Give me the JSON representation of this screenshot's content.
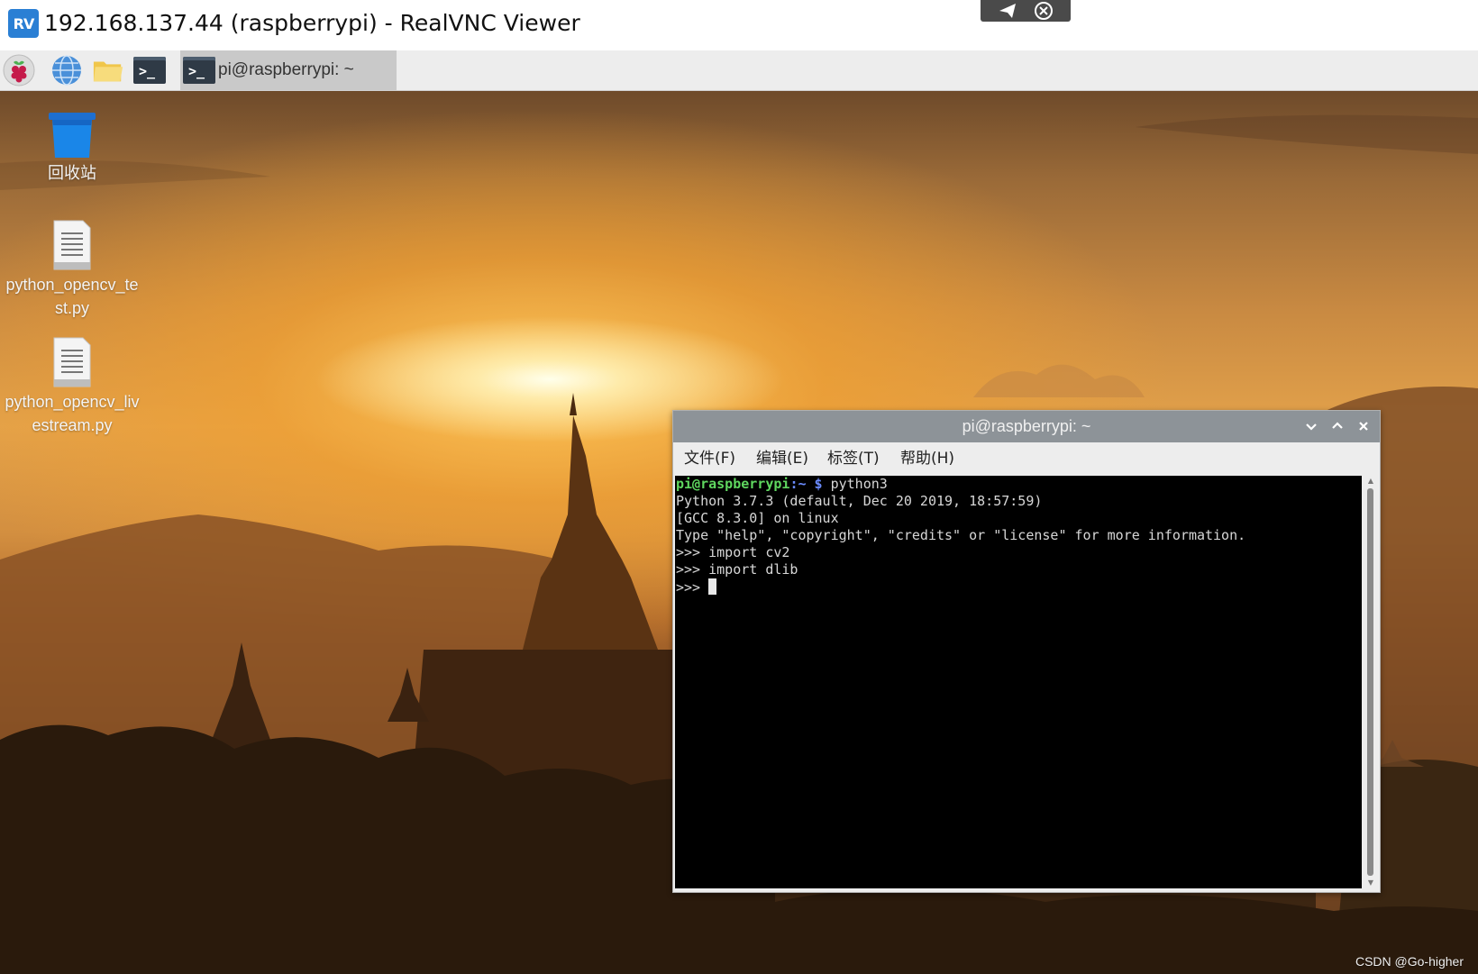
{
  "vnc": {
    "logo_text": "RV",
    "title": "192.168.137.44 (raspberrypi) - RealVNC Viewer",
    "toolbar_icons": [
      "send-icon",
      "close-circle-icon"
    ]
  },
  "taskbar": {
    "launchers": [
      "raspberry-menu-icon",
      "web-browser-icon",
      "file-manager-icon",
      "terminal-icon"
    ],
    "active_task_label": "pi@raspberrypi: ~"
  },
  "desktop": {
    "icons": [
      {
        "label": "回收站",
        "icon": "trash-icon"
      },
      {
        "label": "python_opencv_test.py",
        "icon": "text-file-icon"
      },
      {
        "label": "python_opencv_livestream.py",
        "icon": "text-file-icon"
      }
    ]
  },
  "terminal": {
    "title": "pi@raspberrypi: ~",
    "menu": [
      "文件(F)",
      "编辑(E)",
      "标签(T)",
      "帮助(H)"
    ],
    "prompt_user": "pi@raspberrypi",
    "prompt_dir": ":~ $",
    "command": " python3",
    "output": [
      "Python 3.7.3 (default, Dec 20 2019, 18:57:59)",
      "[GCC 8.3.0] on linux",
      "Type \"help\", \"copyright\", \"credits\" or \"license\" for more information.",
      ">>> import cv2",
      ">>> import dlib"
    ],
    "current_prompt": ">>> "
  },
  "watermark": "CSDN @Go-higher",
  "colors": {
    "vnc_accent": "#2a7fd4",
    "terminal_titlebar": "#8d9398",
    "prompt_user": "#5fd75f",
    "prompt_dir": "#6b8cff"
  }
}
